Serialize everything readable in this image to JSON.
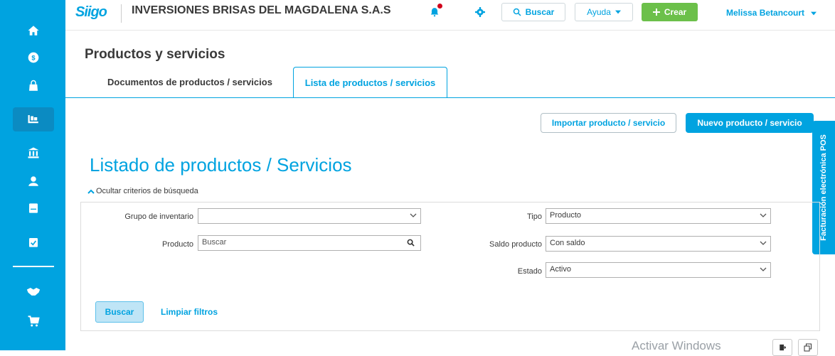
{
  "colors": {
    "brand": "#00a3e0",
    "create": "#6cc04a",
    "notification": "#d0021b"
  },
  "sidebar": {
    "items": [
      {
        "icon": "home-icon"
      },
      {
        "icon": "money-icon"
      },
      {
        "icon": "shopping-bag-icon"
      },
      {
        "icon": "inventory-cart-icon",
        "active": true
      },
      {
        "icon": "bank-icon"
      },
      {
        "icon": "user-icon"
      },
      {
        "icon": "book-icon"
      },
      {
        "icon": "clipboard-check-icon"
      },
      {
        "icon": "handshake-icon"
      },
      {
        "icon": "cart-icon"
      }
    ]
  },
  "header": {
    "logo": "Siigo",
    "company": "INVERSIONES BRISAS DEL MAGDALENA S.A.S",
    "search_label": "Buscar",
    "help_label": "Ayuda",
    "create_label": "Crear",
    "user_name": "Melissa Betancourt"
  },
  "page": {
    "title": "Productos y servicios",
    "tabs": [
      {
        "label": "Documentos de productos / servicios",
        "active": false
      },
      {
        "label": "Lista de productos / servicios",
        "active": true
      }
    ],
    "import_button": "Importar producto / servicio",
    "new_button": "Nuevo producto / servicio",
    "pos_tab": "Facturación electrónica POS",
    "list_title": "Listado de productos / Servicios",
    "toggle_criteria": "Ocultar criterios de búsqueda"
  },
  "filters": {
    "inventory_group": {
      "label": "Grupo de inventario",
      "value": ""
    },
    "product": {
      "label": "Producto",
      "placeholder": "Buscar"
    },
    "type": {
      "label": "Tipo",
      "value": "Producto"
    },
    "balance": {
      "label": "Saldo producto",
      "value": "Con saldo"
    },
    "status": {
      "label": "Estado",
      "value": "Activo"
    },
    "search_button": "Buscar",
    "clear_link": "Limpiar filtros"
  },
  "watermark": "Activar Windows"
}
